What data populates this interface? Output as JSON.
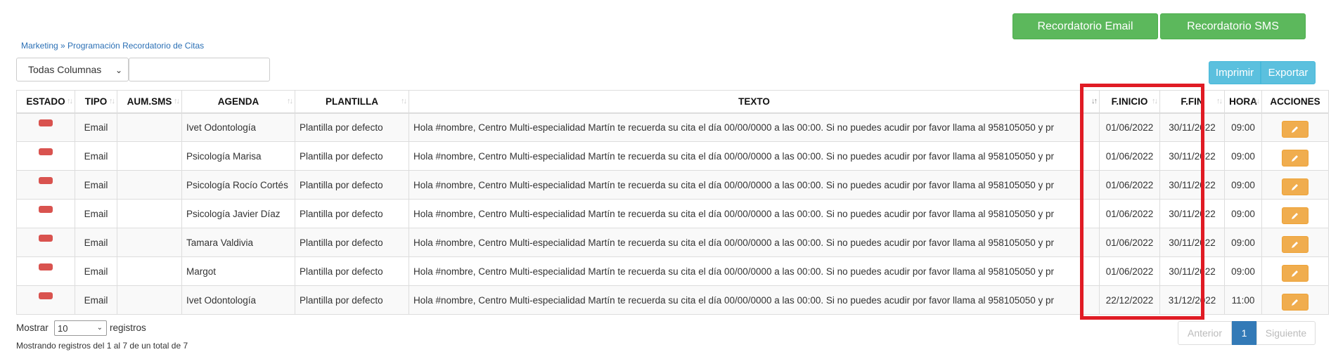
{
  "header": {
    "email_button": "Recordatorio Email",
    "sms_button": "Recordatorio SMS"
  },
  "breadcrumb": {
    "parent": "Marketing",
    "separator": " » ",
    "current": "Programación Recordatorio de Citas"
  },
  "filter": {
    "columns_select": "Todas Columnas",
    "search_value": ""
  },
  "toolbar": {
    "print_label": "Imprimir",
    "export_label": "Exportar"
  },
  "table": {
    "columns": [
      "ESTADO",
      "TIPO",
      "AUM.SMS",
      "AGENDA",
      "PLANTILLA",
      "TEXTO",
      "F.INICIO",
      "F.FIN",
      "HORA",
      "ACCIONES"
    ],
    "rows": [
      {
        "tipo": "Email",
        "aum": "",
        "agenda": "Ivet Odontología",
        "plantilla": "Plantilla por defecto",
        "texto": "Hola #nombre, Centro Multi-especialidad Martín  te recuerda su cita el día 00/00/0000 a las 00:00. Si no puedes acudir por favor llama al 958105050 y pr",
        "inicio": "01/06/2022",
        "fin": "30/11/2022",
        "hora": "09:00"
      },
      {
        "tipo": "Email",
        "aum": "",
        "agenda": "Psicología Marisa",
        "plantilla": "Plantilla por defecto",
        "texto": "Hola #nombre, Centro Multi-especialidad Martín  te recuerda su cita el día 00/00/0000 a las 00:00. Si no puedes acudir por favor llama al 958105050 y pr",
        "inicio": "01/06/2022",
        "fin": "30/11/2022",
        "hora": "09:00"
      },
      {
        "tipo": "Email",
        "aum": "",
        "agenda": "Psicología Rocío Cortés",
        "plantilla": "Plantilla por defecto",
        "texto": "Hola #nombre, Centro Multi-especialidad Martín  te recuerda su cita el día 00/00/0000 a las 00:00. Si no puedes acudir por favor llama al 958105050 y pr",
        "inicio": "01/06/2022",
        "fin": "30/11/2022",
        "hora": "09:00"
      },
      {
        "tipo": "Email",
        "aum": "",
        "agenda": "Psicología Javier Díaz",
        "plantilla": "Plantilla por defecto",
        "texto": "Hola #nombre, Centro Multi-especialidad Martín  te recuerda su cita el día 00/00/0000 a las 00:00. Si no puedes acudir por favor llama al 958105050 y pr",
        "inicio": "01/06/2022",
        "fin": "30/11/2022",
        "hora": "09:00"
      },
      {
        "tipo": "Email",
        "aum": "",
        "agenda": "Tamara Valdivia",
        "plantilla": "Plantilla por defecto",
        "texto": "Hola #nombre, Centro Multi-especialidad Martín  te recuerda su cita el día 00/00/0000 a las 00:00. Si no puedes acudir por favor llama al 958105050 y pr",
        "inicio": "01/06/2022",
        "fin": "30/11/2022",
        "hora": "09:00"
      },
      {
        "tipo": "Email",
        "aum": "",
        "agenda": "Margot",
        "plantilla": "Plantilla por defecto",
        "texto": "Hola #nombre, Centro Multi-especialidad Martín  te recuerda su cita el día 00/00/0000 a las 00:00. Si no puedes acudir por favor llama al 958105050 y pr",
        "inicio": "01/06/2022",
        "fin": "30/11/2022",
        "hora": "09:00"
      },
      {
        "tipo": "Email",
        "aum": "",
        "agenda": "Ivet Odontología",
        "plantilla": "Plantilla por defecto",
        "texto": "Hola #nombre, Centro Multi-especialidad Martín  te recuerda su cita el día 00/00/0000 a las 00:00. Si no puedes acudir por favor llama al 958105050 y pr",
        "inicio": "22/12/2022",
        "fin": "31/12/2022",
        "hora": "11:00"
      }
    ]
  },
  "footer": {
    "show_prefix": "Mostrar",
    "page_length": "10",
    "show_suffix": "registros",
    "info": "Mostrando registros del 1 al 7 de un total de 7"
  },
  "pagination": {
    "prev": "Anterior",
    "current": "1",
    "next": "Siguiente"
  },
  "colors": {
    "green": "#5cb85c",
    "blue": "#5bc0de",
    "status_red": "#d9534f",
    "edit_orange": "#f0ad4e",
    "highlight_red": "#e01b24"
  }
}
